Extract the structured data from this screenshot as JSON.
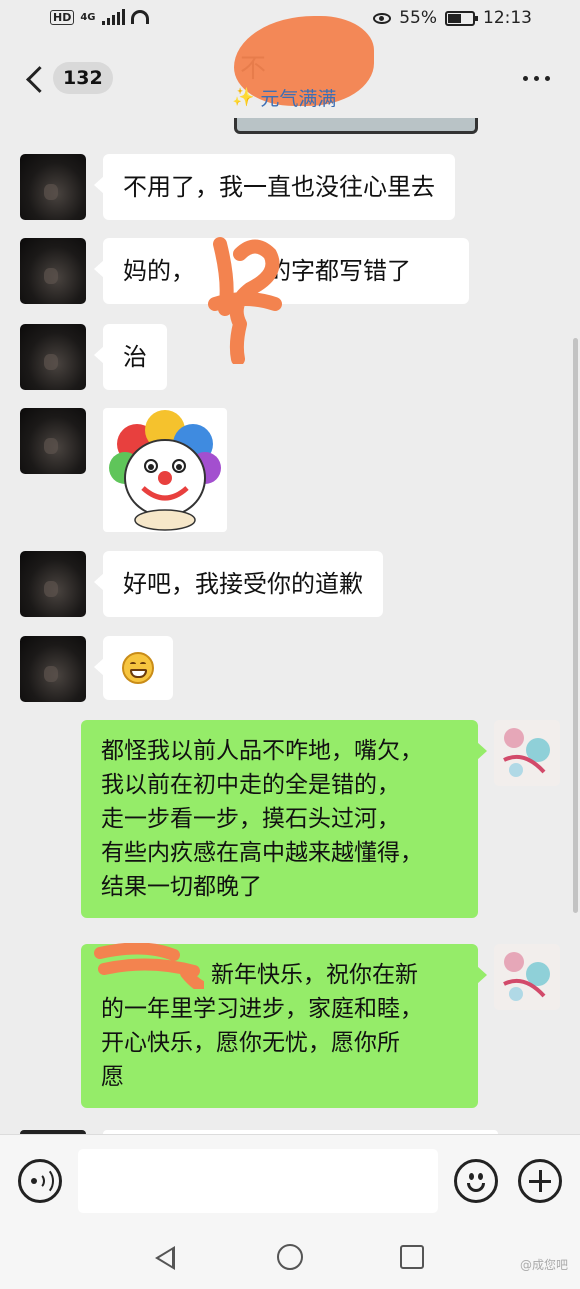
{
  "status_bar": {
    "hd": "HD",
    "network": "4G",
    "battery_percent": "55%",
    "battery_level": 0.55,
    "time": "12:13"
  },
  "header": {
    "unread_count": "132",
    "title": "不",
    "subtitle": "元气满满"
  },
  "messages": [
    {
      "side": "left",
      "type": "text",
      "text": "不用了，我一直也没往心里去"
    },
    {
      "side": "left",
      "type": "text",
      "text": "妈的，",
      "text_tail": "的字都写错了"
    },
    {
      "side": "left",
      "type": "text",
      "text": "治"
    },
    {
      "side": "left",
      "type": "sticker",
      "icon": "clown-sticker"
    },
    {
      "side": "left",
      "type": "text",
      "text": "好吧，我接受你的道歉"
    },
    {
      "side": "left",
      "type": "emoji",
      "icon": "grinning-emoji"
    },
    {
      "side": "right",
      "type": "text",
      "lines": [
        "都怪我以前人品不咋地，嘴欠，",
        "我以前在初中走的全是错的，",
        "走一步看一步，摸石头过河，",
        "有些内疚感在高中越来越懂得，",
        "结果一切都晚了"
      ]
    },
    {
      "side": "right",
      "type": "text",
      "lines": [
        "新年快乐，祝你在新",
        "的一年里学习进步，家庭和睦，",
        "开心快乐，愿你无忧，愿你所",
        "愿"
      ]
    }
  ],
  "input": {
    "placeholder": ""
  },
  "colors": {
    "sent_bubble": "#95ec69",
    "received_bubble": "#ffffff",
    "background": "#ededed",
    "subtitle": "#3b6fb6",
    "redaction": "#f3834f"
  },
  "icons": [
    "back-icon",
    "more-icon",
    "voice-icon",
    "emoji-icon",
    "plus-icon",
    "nav-back-icon",
    "nav-home-icon",
    "nav-recent-icon"
  ],
  "watermark": "@成您吧"
}
